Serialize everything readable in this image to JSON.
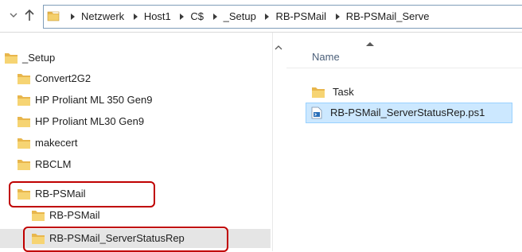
{
  "address_bar": {
    "crumbs": [
      "Netzwerk",
      "Host1",
      "C$",
      "_Setup",
      "RB-PSMail",
      "RB-PSMail_Serve"
    ]
  },
  "tree": {
    "items": [
      {
        "label": "_Setup"
      },
      {
        "label": "Convert2G2"
      },
      {
        "label": "HP Proliant ML 350 Gen9"
      },
      {
        "label": "HP Proliant ML30 Gen9"
      },
      {
        "label": "makecert"
      },
      {
        "label": "RBCLM"
      },
      {
        "label": "RB-PSMail"
      },
      {
        "label": "RB-PSMail"
      },
      {
        "label": "RB-PSMail_ServerStatusRep"
      }
    ]
  },
  "content": {
    "column_name": "Name",
    "files": [
      {
        "name": "Task",
        "icon": "folder-icon"
      },
      {
        "name": "RB-PSMail_ServerStatusRep.ps1",
        "icon": "powershell-script-icon"
      }
    ]
  },
  "colors": {
    "highlight": "#c00000",
    "selection": "#cce8ff",
    "folder": "#e8b64c"
  }
}
